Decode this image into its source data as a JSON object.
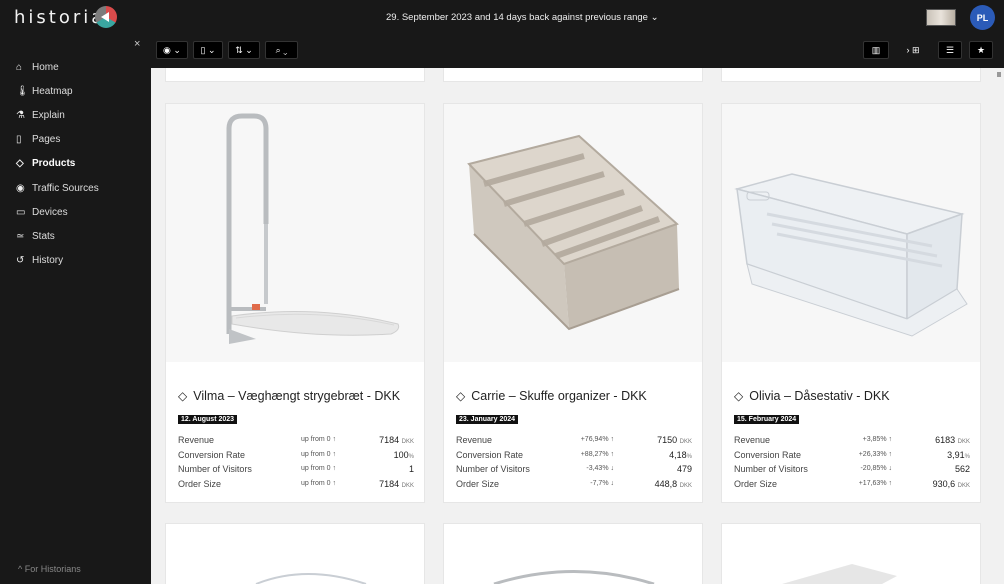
{
  "app": {
    "brand": "historian",
    "date_range": "29. September 2023 and 14 days back against previous range ⌄",
    "avatar_initials": "PL"
  },
  "sidebar": {
    "close": "×",
    "items": [
      {
        "icon": "home-icon",
        "glyph": "⌂",
        "label": "Home",
        "active": false
      },
      {
        "icon": "thermometer-icon",
        "glyph": "🌡",
        "label": "Heatmap",
        "active": false
      },
      {
        "icon": "flask-icon",
        "glyph": "⚗",
        "label": "Explain",
        "active": false
      },
      {
        "icon": "page-icon",
        "glyph": "▯",
        "label": "Pages",
        "active": false
      },
      {
        "icon": "tag-icon",
        "glyph": "◇",
        "label": "Products",
        "active": true
      },
      {
        "icon": "globe-icon",
        "glyph": "◉",
        "label": "Traffic Sources",
        "active": false
      },
      {
        "icon": "monitor-icon",
        "glyph": "▭",
        "label": "Devices",
        "active": false
      },
      {
        "icon": "stats-icon",
        "glyph": "≃",
        "label": "Stats",
        "active": false
      },
      {
        "icon": "history-icon",
        "glyph": "↺",
        "label": "History",
        "active": false
      }
    ],
    "footer": "^ For Historians"
  },
  "toolbar": {
    "left": [
      {
        "name": "globe-filter-button",
        "label": "◉ ⌄"
      },
      {
        "name": "page-filter-button",
        "label": "▯ ⌄"
      },
      {
        "name": "sort-filter-button",
        "label": "⇅ ⌄"
      },
      {
        "name": "search-filter-button",
        "label": "⌕ ⌄"
      }
    ],
    "right": [
      {
        "name": "chart-view-button",
        "label": "▥"
      },
      {
        "name": "grid-view-button",
        "label": "› ⊞"
      },
      {
        "name": "list-view-button",
        "label": "☰"
      },
      {
        "name": "favorite-button",
        "label": "★"
      }
    ]
  },
  "cards": [
    {
      "title": "Vilma – Væghængt strygebræt - DKK",
      "date": "12. August 2023",
      "image": "ironing-board",
      "metrics": [
        {
          "label": "Revenue",
          "change": "up from 0 ↑",
          "trend": "up",
          "value": "7184",
          "unit": "DKK"
        },
        {
          "label": "Conversion Rate",
          "change": "up from 0 ↑",
          "trend": "up",
          "value": "100",
          "unit": "%"
        },
        {
          "label": "Number of Visitors",
          "change": "up from 0 ↑",
          "trend": "up",
          "value": "1",
          "unit": ""
        },
        {
          "label": "Order Size",
          "change": "up from 0 ↑",
          "trend": "up",
          "value": "7184",
          "unit": "DKK"
        }
      ]
    },
    {
      "title": "Carrie – Skuffe organizer - DKK",
      "date": "23. January 2024",
      "image": "drawer-organizer",
      "metrics": [
        {
          "label": "Revenue",
          "change": "+76,94% ↑",
          "trend": "up",
          "value": "7150",
          "unit": "DKK"
        },
        {
          "label": "Conversion Rate",
          "change": "+88,27% ↑",
          "trend": "up",
          "value": "4,18",
          "unit": "%"
        },
        {
          "label": "Number of Visitors",
          "change": "-3,43% ↓",
          "trend": "down",
          "value": "479",
          "unit": ""
        },
        {
          "label": "Order Size",
          "change": "-7,7% ↓",
          "trend": "down",
          "value": "448,8",
          "unit": "DKK"
        }
      ]
    },
    {
      "title": "Olivia – Dåsestativ - DKK",
      "date": "15. February 2024",
      "image": "can-rack",
      "metrics": [
        {
          "label": "Revenue",
          "change": "+3,85% ↑",
          "trend": "up",
          "value": "6183",
          "unit": "DKK"
        },
        {
          "label": "Conversion Rate",
          "change": "+26,33% ↑",
          "trend": "up",
          "value": "3,91",
          "unit": "%"
        },
        {
          "label": "Number of Visitors",
          "change": "-20,85% ↓",
          "trend": "down",
          "value": "562",
          "unit": ""
        },
        {
          "label": "Order Size",
          "change": "+17,63% ↑",
          "trend": "up",
          "value": "930,6",
          "unit": "DKK"
        }
      ]
    }
  ]
}
